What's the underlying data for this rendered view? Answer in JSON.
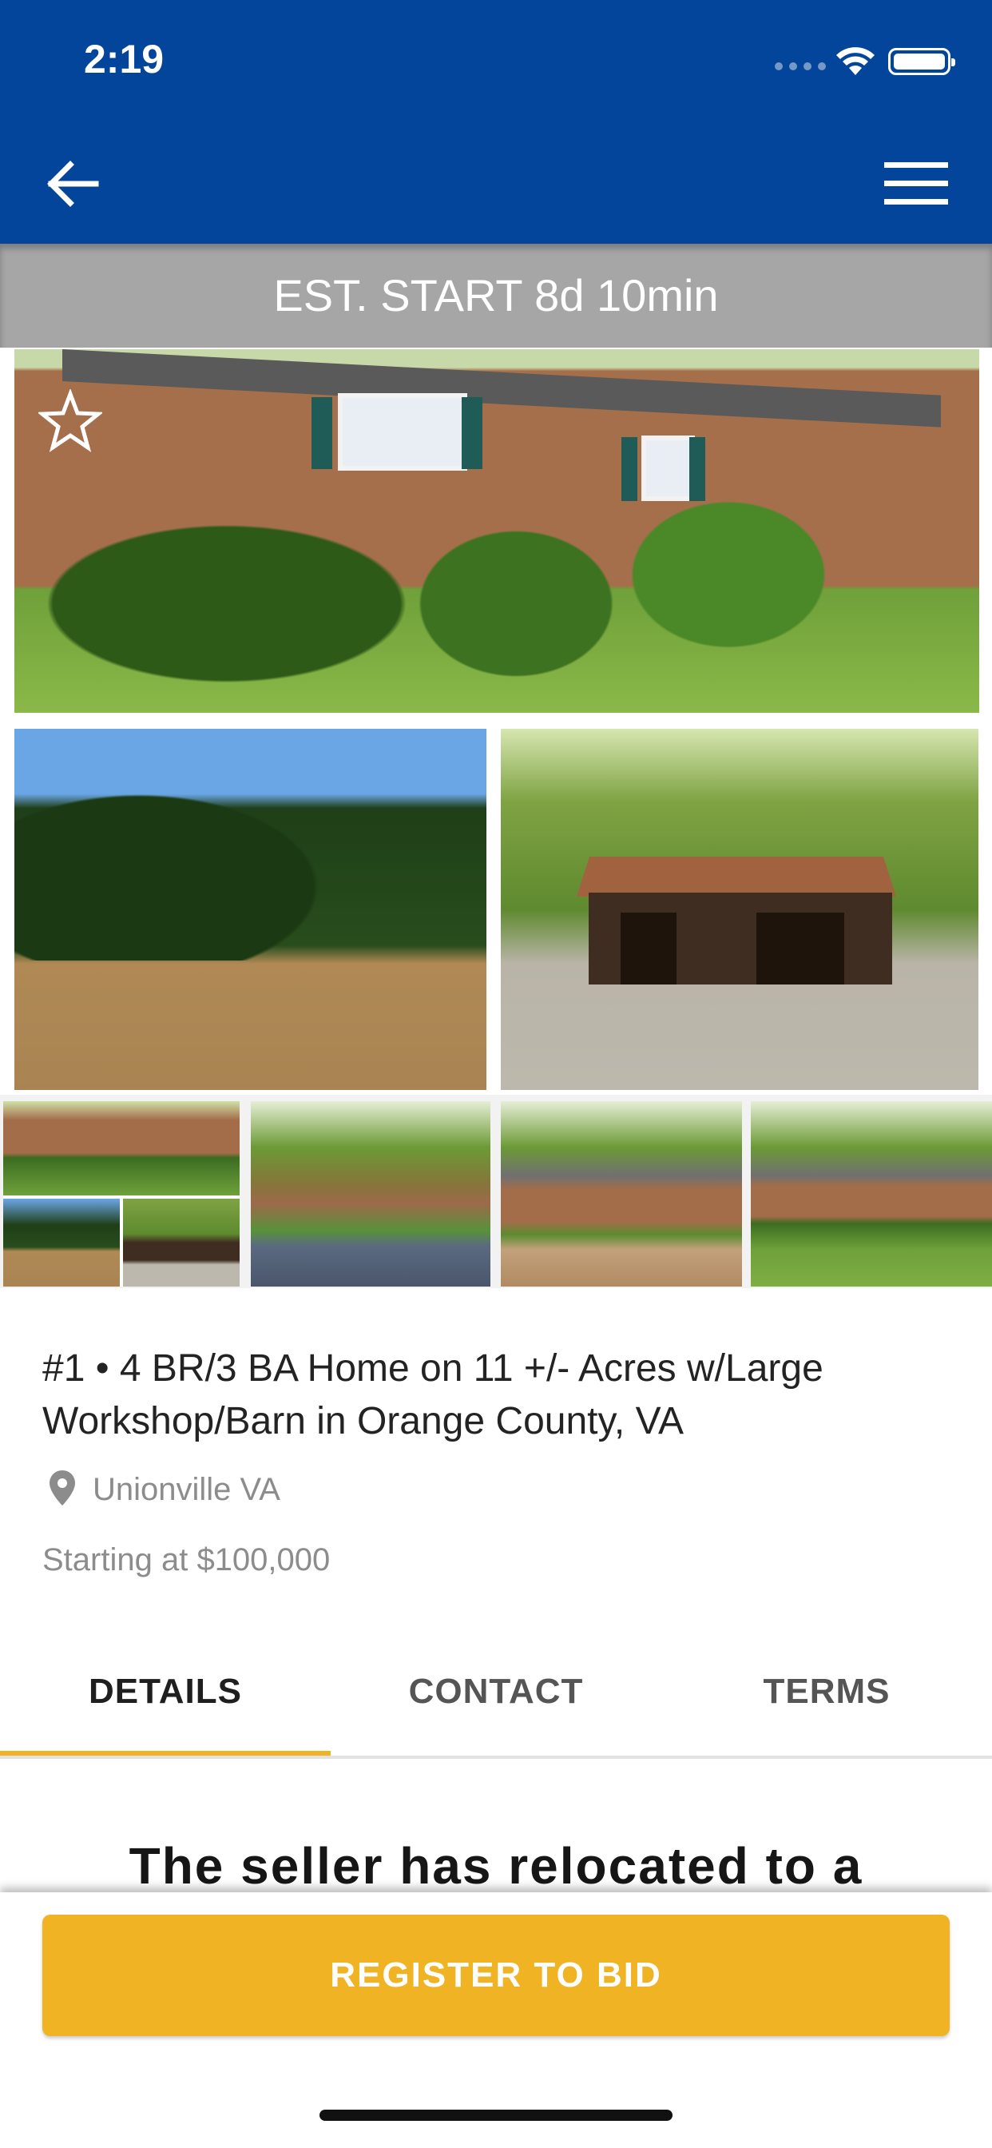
{
  "status_bar": {
    "time": "2:19"
  },
  "nav": {
    "back_icon": "arrow-left-icon",
    "menu_icon": "hamburger-menu-icon"
  },
  "banner": {
    "text": "EST. START 8d 10min"
  },
  "gallery": {
    "favorite_icon": "star-outline-icon",
    "thumbnail_count": 4
  },
  "listing": {
    "title": "#1 • 4 BR/3 BA Home on 11 +/- Acres w/Large Workshop/Barn in Orange County, VA",
    "location_icon": "map-pin-icon",
    "location": "Unionville VA",
    "price": "Starting at $100,000"
  },
  "tabs": [
    {
      "label": "DETAILS",
      "active": true
    },
    {
      "label": "CONTACT",
      "active": false
    },
    {
      "label": "TERMS",
      "active": false
    }
  ],
  "details": {
    "text": "The seller has relocated to a"
  },
  "actions": {
    "register_label": "REGISTER TO BID"
  },
  "colors": {
    "brand_blue": "#03459a",
    "accent_gold": "#f0b323",
    "banner_gray": "#a6a6a6"
  }
}
